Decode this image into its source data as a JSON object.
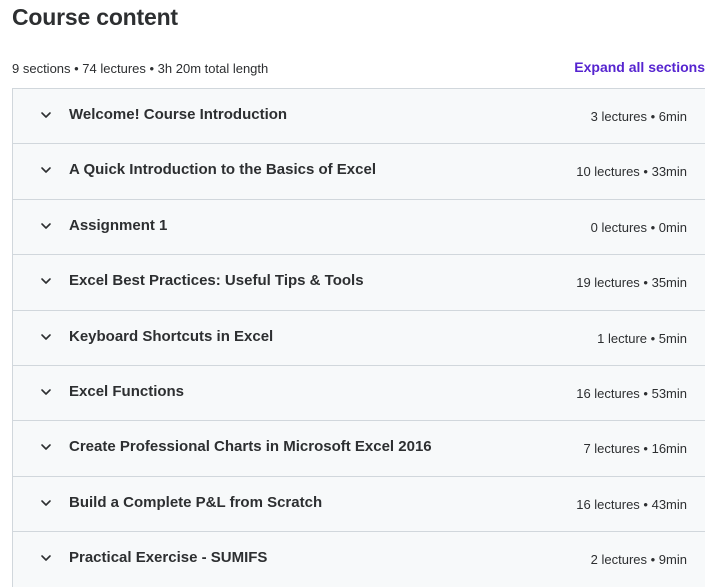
{
  "header": {
    "title": "Course content",
    "summary": "9 sections • 74 lectures • 3h 20m total length",
    "expand_label": "Expand all sections"
  },
  "sections": [
    {
      "title": "Welcome! Course Introduction",
      "meta": "3 lectures • 6min"
    },
    {
      "title": "A Quick Introduction to the Basics of Excel",
      "meta": "10 lectures • 33min"
    },
    {
      "title": "Assignment 1",
      "meta": "0 lectures • 0min"
    },
    {
      "title": "Excel Best Practices: Useful Tips & Tools",
      "meta": "19 lectures • 35min"
    },
    {
      "title": "Keyboard Shortcuts in Excel",
      "meta": "1 lecture • 5min"
    },
    {
      "title": "Excel Functions",
      "meta": "16 lectures • 53min"
    },
    {
      "title": "Create Professional Charts in Microsoft Excel 2016",
      "meta": "7 lectures • 16min"
    },
    {
      "title": "Build a Complete P&L from Scratch",
      "meta": "16 lectures • 43min"
    },
    {
      "title": "Practical Exercise - SUMIFS",
      "meta": "2 lectures • 9min"
    }
  ],
  "icons": {
    "section_toggle": "chevron-down-icon"
  },
  "colors": {
    "accent": "#5624d0",
    "text": "#2d2f31",
    "panel_bg": "#f7f9fa",
    "border": "#d1d7dc"
  }
}
